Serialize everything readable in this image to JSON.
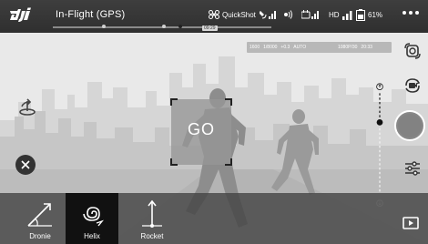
{
  "topbar": {
    "flight_mode": "In-Flight (GPS)",
    "record_time": "09:29",
    "quickshot_label": "QuickShot",
    "hd_label": "HD",
    "battery_percent": "61%"
  },
  "camera": {
    "iso": "1600",
    "shutter": "1/8000",
    "ev": "+0.3",
    "wb": "AUTO",
    "resolution": "1080P/30",
    "remaining": "20:33"
  },
  "target": {
    "go_label": "GO"
  },
  "modes": [
    {
      "label": "Dronie",
      "icon": "dronie-icon",
      "active": false
    },
    {
      "label": "Helix",
      "icon": "helix-icon",
      "active": true
    },
    {
      "label": "Rocket",
      "icon": "rocket-icon",
      "active": false
    }
  ],
  "colors": {
    "shutter": "#8a8a8a",
    "active_mode": "#111111",
    "bar": "#3a3a3a"
  }
}
